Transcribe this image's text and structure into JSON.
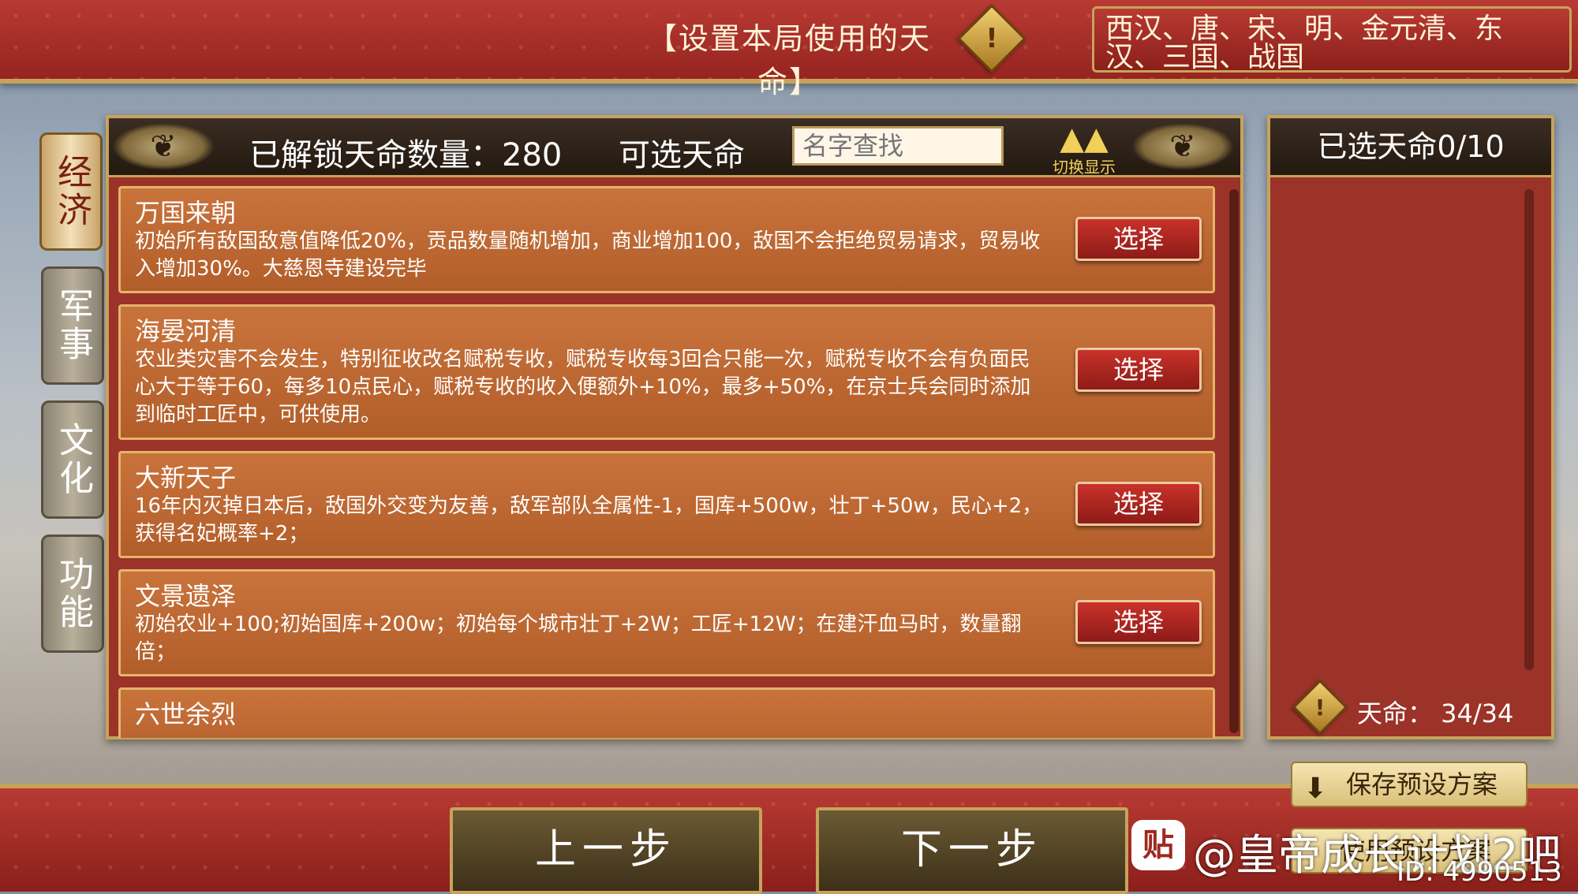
{
  "header": {
    "title": "【设置本局使用的天命】",
    "warning_icon": "!",
    "dynasties": "西汉、唐、宋、明、金元清、东汉、三国、战国"
  },
  "side_tabs": [
    "经济",
    "军事",
    "文化",
    "功能"
  ],
  "main": {
    "unlocked_label": "已解锁天命数量：280",
    "selectable_label": "可选天命",
    "search_placeholder": "名字查找",
    "sort_label": "切换显示",
    "cards": [
      {
        "title": "万国来朝",
        "desc": "初始所有敌国敌意值降低20%，贡品数量随机增加，商业增加100，敌国不会拒绝贸易请求，贸易收入增加30%。大慈恩寺建设完毕",
        "button": "选择"
      },
      {
        "title": "海晏河清",
        "desc": "农业类灾害不会发生，特别征收改名赋税专收，赋税专收每3回合只能一次，赋税专收不会有负面民心大于等于60，每多10点民心，赋税专收的收入便额外+10%，最多+50%，在京士兵会同时添加到临时工匠中，可供使用。",
        "button": "选择"
      },
      {
        "title": "大新天子",
        "desc": "16年内灭掉日本后，敌国外交变为友善，敌军部队全属性-1，国库+500w，壮丁+50w，民心+2，获得名妃概率+2；",
        "button": "选择"
      },
      {
        "title": "文景遗泽",
        "desc": "初始农业+100;初始国库+200w；初始每个城市壮丁+2W；工匠+12W；在建汗血马时，数量翻倍；",
        "button": "选择"
      },
      {
        "title": "六世余烈",
        "desc": "",
        "button": ""
      }
    ]
  },
  "right": {
    "selected_label": "已选天命0/10",
    "quota_label": "天命：  34/34"
  },
  "bottom": {
    "prev": "上一步",
    "next": "下一步",
    "save_preset": "保存预设方案",
    "use_preset": "使用预设方案",
    "watermark": "@皇帝成长计划2吧",
    "watermark_logo": "贴",
    "watermark_id": "ID: 4990513"
  },
  "colors": {
    "accent_red": "#9b3328",
    "gold_border": "#c7a35a",
    "card_orange": "#c9733c"
  }
}
